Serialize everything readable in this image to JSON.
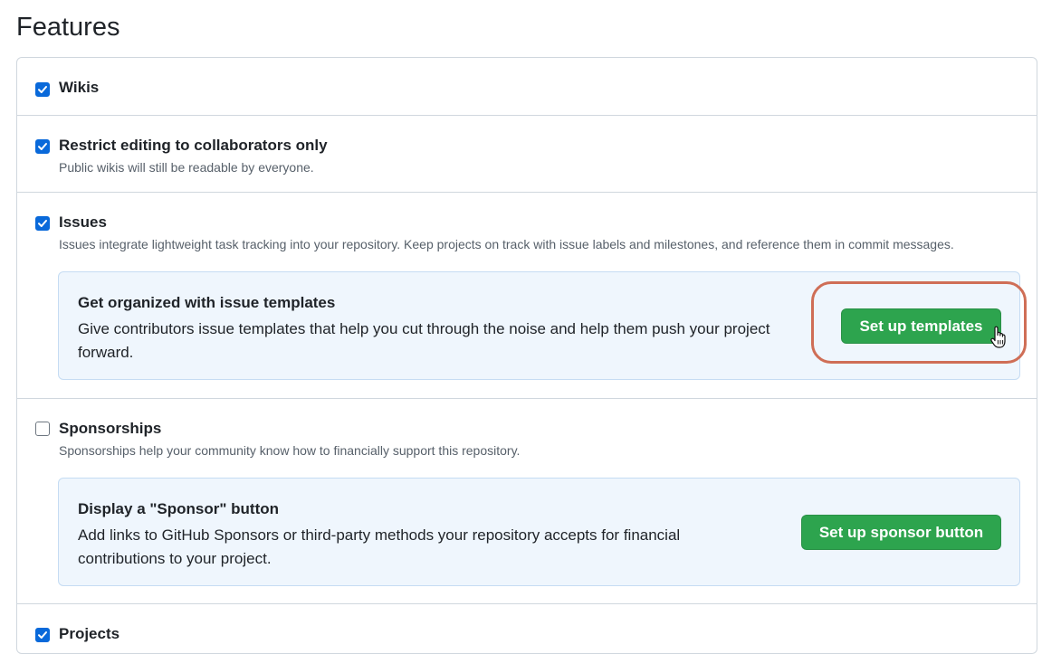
{
  "page": {
    "title": "Features"
  },
  "features": {
    "wikis": {
      "label": "Wikis",
      "checked": true
    },
    "restrict_editing": {
      "label": "Restrict editing to collaborators only",
      "description": "Public wikis will still be readable by everyone.",
      "checked": true
    },
    "issues": {
      "label": "Issues",
      "description": "Issues integrate lightweight task tracking into your repository. Keep projects on track with issue labels and milestones, and reference them in commit messages.",
      "checked": true,
      "promo": {
        "title": "Get organized with issue templates",
        "description": "Give contributors issue templates that help you cut through the noise and help them push your project forward.",
        "button_label": "Set up templates"
      }
    },
    "sponsorships": {
      "label": "Sponsorships",
      "description": "Sponsorships help your community know how to financially support this repository.",
      "checked": false,
      "promo": {
        "title": "Display a \"Sponsor\" button",
        "description": "Add links to GitHub Sponsors or third-party methods your repository accepts for financial contributions to your project.",
        "button_label": "Set up sponsor button"
      }
    },
    "projects": {
      "label": "Projects",
      "checked": true
    }
  },
  "colors": {
    "checkbox_checked": "#0969da",
    "button_green": "#2da44e",
    "promo_background": "#eff6fd",
    "highlight_ring": "#cf6e56"
  }
}
